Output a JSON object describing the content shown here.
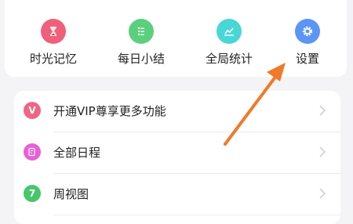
{
  "quick_actions": [
    {
      "label": "时光记忆",
      "icon": "hourglass-icon",
      "color": "#f0607a"
    },
    {
      "label": "每日小结",
      "icon": "list-icon",
      "color": "#5ad07e"
    },
    {
      "label": "全局统计",
      "icon": "line-chart-icon",
      "color": "#49d6d6"
    },
    {
      "label": "设置",
      "icon": "gear-icon",
      "color": "#5b95f5"
    }
  ],
  "menu": [
    {
      "label": "开通VIP尊享更多功能",
      "badge": "V",
      "icon": "vip-icon",
      "color": "#f06587"
    },
    {
      "label": "全部日程",
      "badge": "",
      "icon": "document-edit-icon",
      "color": "#e85fd8"
    },
    {
      "label": "周视图",
      "badge": "7",
      "icon": "week-calendar-icon",
      "color": "#47c66b"
    }
  ],
  "annotation": {
    "arrow_color": "#f07a2a"
  }
}
